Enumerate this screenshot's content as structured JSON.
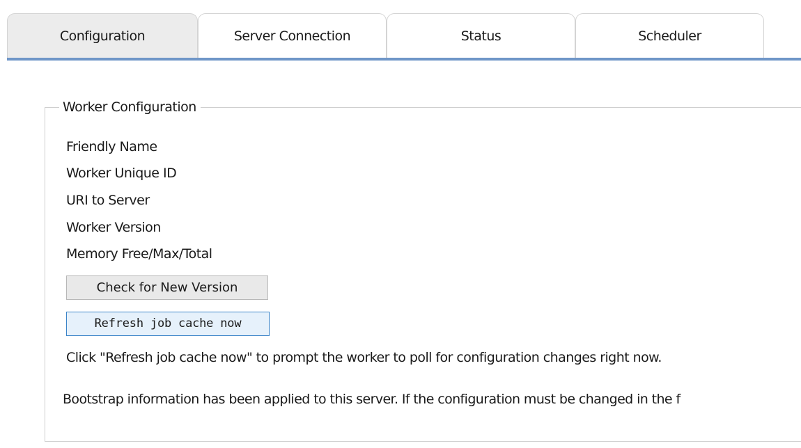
{
  "tabs": [
    {
      "label": "Configuration",
      "active": true
    },
    {
      "label": "Server Connection",
      "active": false
    },
    {
      "label": "Status",
      "active": false
    },
    {
      "label": "Scheduler",
      "active": false
    }
  ],
  "accent_color": "#6f96c8",
  "worker_config": {
    "legend": "Worker Configuration",
    "fields": [
      {
        "label": "Friendly Name"
      },
      {
        "label": "Worker Unique ID"
      },
      {
        "label": "URI to Server"
      },
      {
        "label": "Worker Version"
      },
      {
        "label": "Memory Free/Max/Total"
      }
    ],
    "check_version_button": "Check for New Version",
    "refresh_cache_button": "Refresh job cache now",
    "refresh_hint": "Click \"Refresh job cache now\" to prompt the worker to poll for configuration changes right now.",
    "bootstrap_notice": "Bootstrap information has been applied to this server. If the configuration must be changed in the f"
  }
}
